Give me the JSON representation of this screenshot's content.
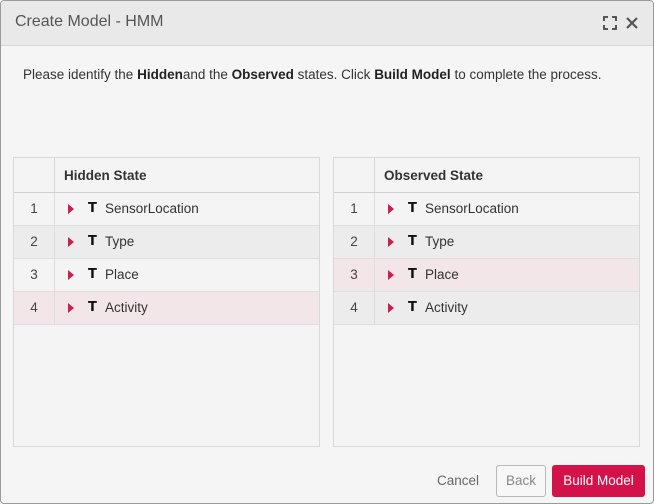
{
  "dialog": {
    "title": "Create Model - HMM",
    "maximize_icon": "maximize-icon",
    "close_icon": "close-icon"
  },
  "instructions": {
    "part1": "Please identify the ",
    "hidden": "Hidden",
    "part2": "and the ",
    "observed": "Observed",
    "part3": " states. Click ",
    "build": "Build Model",
    "part4": " to complete the process."
  },
  "hidden_state": {
    "header": "Hidden State",
    "rows": [
      {
        "num": "1",
        "type": "T",
        "label": "SensorLocation"
      },
      {
        "num": "2",
        "type": "T",
        "label": "Type"
      },
      {
        "num": "3",
        "type": "T",
        "label": "Place"
      },
      {
        "num": "4",
        "type": "T",
        "label": "Activity"
      }
    ],
    "selected_row": 4
  },
  "observed_state": {
    "header": "Observed State",
    "rows": [
      {
        "num": "1",
        "type": "T",
        "label": "SensorLocation"
      },
      {
        "num": "2",
        "type": "T",
        "label": "Type"
      },
      {
        "num": "3",
        "type": "T",
        "label": "Place"
      },
      {
        "num": "4",
        "type": "T",
        "label": "Activity"
      }
    ],
    "selected_row": 3
  },
  "footer": {
    "cancel_label": "Cancel",
    "back_label": "Back",
    "build_label": "Build Model"
  },
  "colors": {
    "accent": "#d4124a",
    "selected_row_bg": "#f3e6e8"
  }
}
